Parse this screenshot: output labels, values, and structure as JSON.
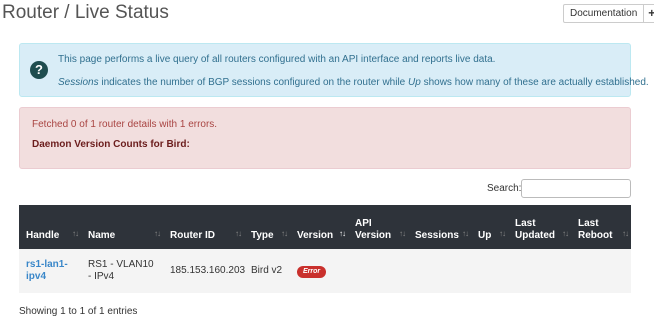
{
  "page": {
    "title": "Router / Live Status"
  },
  "toolbar": {
    "documentation_label": "Documentation",
    "add_label": "+"
  },
  "info_alert": {
    "icon": "question-circle-icon",
    "line1": "This page performs a live query of all routers configured with an API interface and reports live data.",
    "line2_em1": "Sessions",
    "line2_mid": " indicates the number of BGP sessions configured on the router while ",
    "line2_em2": "Up",
    "line2_end": " shows how many of these are actually established."
  },
  "error_alert": {
    "message": "Fetched 0 of 1 router details with 1 errors.",
    "heading": "Daemon Version Counts for Bird:"
  },
  "search": {
    "label": "Search:",
    "value": ""
  },
  "table": {
    "columns": [
      {
        "label": "Handle",
        "sort": "↑↓"
      },
      {
        "label": "Name",
        "sort": "↑↓"
      },
      {
        "label": "Router ID",
        "sort": "↑↓"
      },
      {
        "label": "Type",
        "sort": "↑↓"
      },
      {
        "label": "Version",
        "sort": "↑↓"
      },
      {
        "label": "API Version",
        "sort": "↑↓"
      },
      {
        "label": "Sessions",
        "sort": "↑↓"
      },
      {
        "label": "Up",
        "sort": "↑↓"
      },
      {
        "label": "Last Updated",
        "sort": "↑↓"
      },
      {
        "label": "Last Reboot",
        "sort": "↑↓"
      }
    ],
    "rows": [
      {
        "handle": "rs1-lan1-ipv4",
        "name": "RS1 - VLAN10 - IPv4",
        "router_id": "185.153.160.203",
        "type": "Bird v2",
        "version": "Error",
        "api_version": "",
        "sessions": "",
        "up": "",
        "last_updated": "",
        "last_reboot": ""
      }
    ]
  },
  "footer": {
    "info": "Showing 1 to 1 of 1 entries"
  },
  "colors": {
    "info_bg": "#d9edf7",
    "danger_bg": "#f2dede",
    "table_header": "#2e333a",
    "link": "#3a87c9",
    "error_badge": "#c9302c"
  }
}
